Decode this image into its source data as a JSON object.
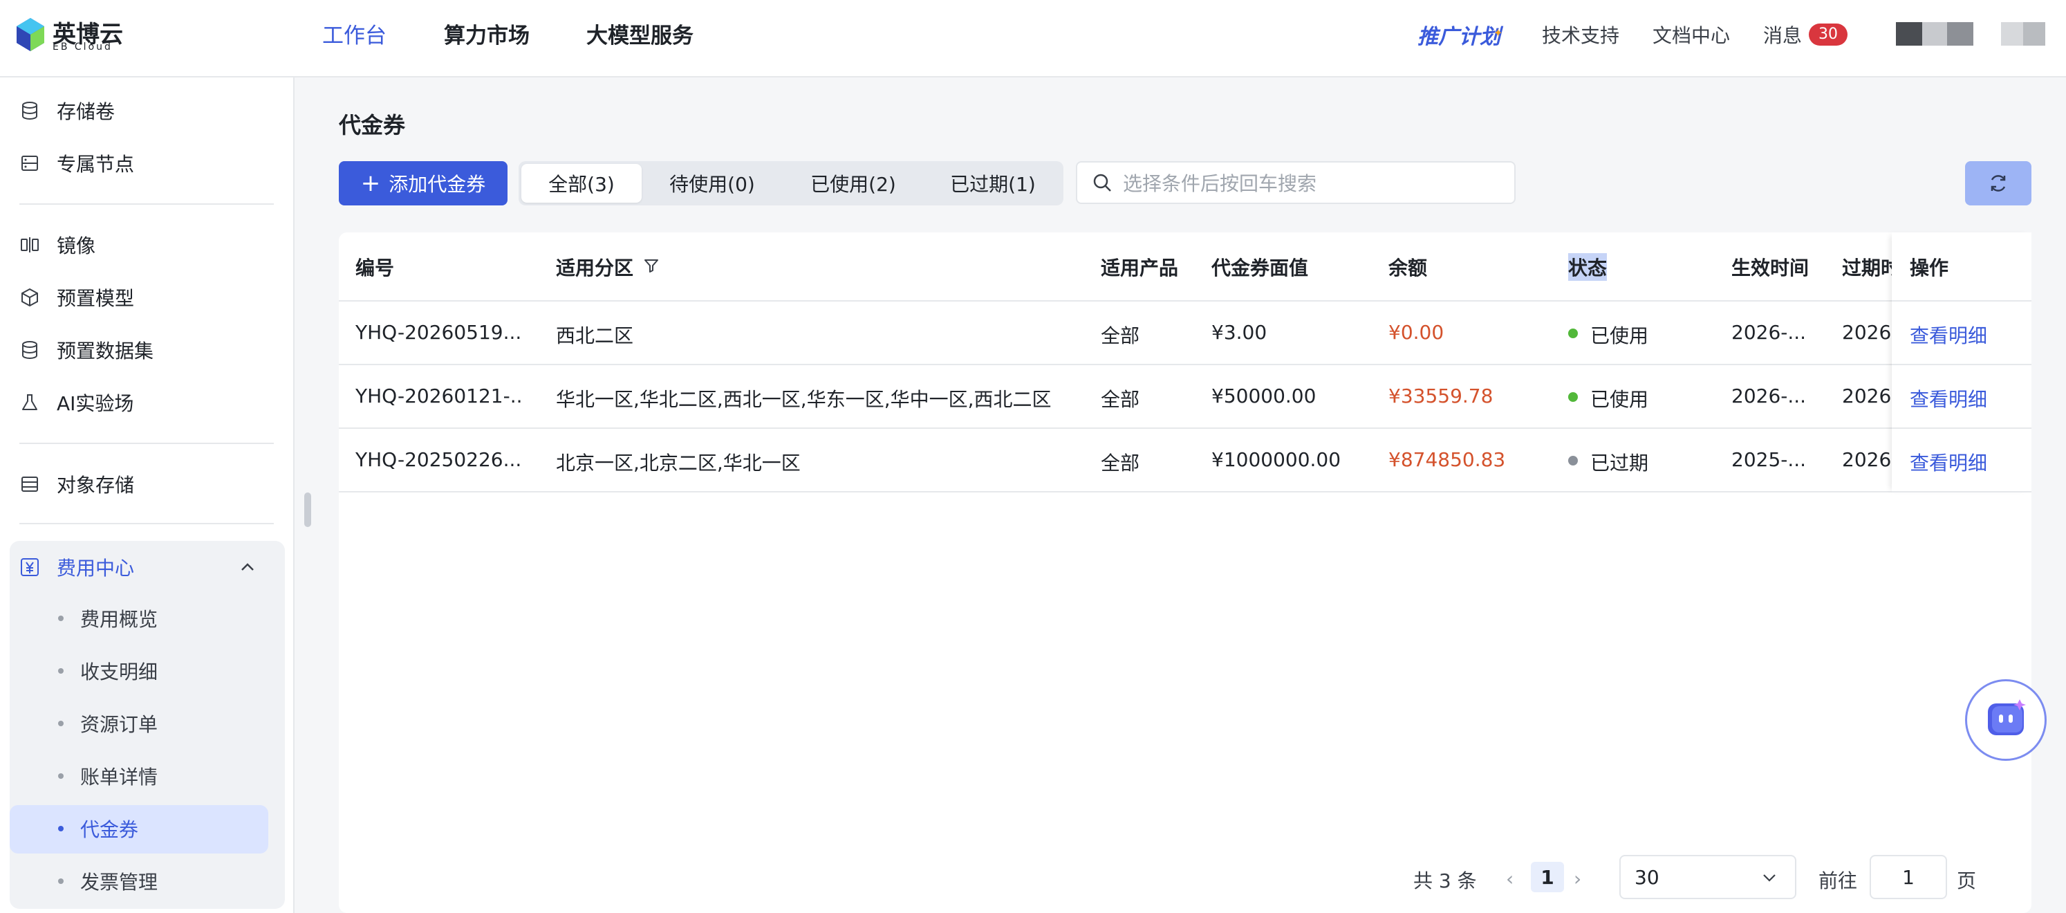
{
  "brand": {
    "name_cn": "英博云",
    "name_en": "EB Cloud"
  },
  "topnav": {
    "items": [
      {
        "label": "工作台",
        "active": true
      },
      {
        "label": "算力市场",
        "active": false
      },
      {
        "label": "大模型服务",
        "active": false
      }
    ],
    "promo": "推广计划",
    "links": [
      "技术支持",
      "文档中心",
      "消息"
    ],
    "message_count": "30"
  },
  "sidebar": {
    "items": [
      {
        "label": "存储卷",
        "icon": "database-icon"
      },
      {
        "label": "专属节点",
        "icon": "server-icon"
      },
      {
        "label": "镜像",
        "icon": "mirror-icon"
      },
      {
        "label": "预置模型",
        "icon": "cube-icon"
      },
      {
        "label": "预置数据集",
        "icon": "database-icon"
      },
      {
        "label": "AI实验场",
        "icon": "flask-icon"
      },
      {
        "label": "对象存储",
        "icon": "storage-icon"
      }
    ],
    "fee_center": {
      "label": "费用中心",
      "icon": "yen-icon",
      "expanded": true,
      "children": [
        "费用概览",
        "收支明细",
        "资源订单",
        "账单详情",
        "代金券",
        "发票管理"
      ],
      "active_child": "代金券"
    }
  },
  "main": {
    "title": "代金券",
    "add_button": "添加代金券",
    "tabs": [
      {
        "label": "全部(3)",
        "active": true
      },
      {
        "label": "待使用(0)",
        "active": false
      },
      {
        "label": "已使用(2)",
        "active": false
      },
      {
        "label": "已过期(1)",
        "active": false
      }
    ],
    "search": {
      "placeholder": "选择条件后按回车搜索",
      "value": ""
    }
  },
  "table": {
    "columns": [
      "编号",
      "适用分区",
      "适用产品",
      "代金券面值",
      "余额",
      "状态",
      "生效时间",
      "过期时",
      "操作"
    ],
    "rows": [
      {
        "id": "YHQ-20260519...",
        "regions": "西北二区",
        "product": "全部",
        "face_value": "¥3.00",
        "balance": "¥0.00",
        "status": "已使用",
        "status_color": "#52b83a",
        "start": "2026-...",
        "expire": "2026-",
        "action": "查看明细"
      },
      {
        "id": "YHQ-20260121-...",
        "regions": "华北一区,华北二区,西北一区,华东一区,华中一区,西北二区",
        "product": "全部",
        "face_value": "¥50000.00",
        "balance": "¥33559.78",
        "status": "已使用",
        "status_color": "#52b83a",
        "start": "2026-...",
        "expire": "2026-",
        "action": "查看明细"
      },
      {
        "id": "YHQ-20250226...",
        "regions": "北京一区,北京二区,华北一区",
        "product": "全部",
        "face_value": "¥1000000.00",
        "balance": "¥874850.83",
        "status": "已过期",
        "status_color": "#8a9099",
        "start": "2025-...",
        "expire": "2026-",
        "action": "查看明细"
      }
    ]
  },
  "pagination": {
    "total_text": "共 3 条",
    "current_page": "1",
    "page_size": "30",
    "goto_label": "前往",
    "goto_value": "1",
    "page_suffix": "页"
  },
  "colors": {
    "accent": "#3b5bdb",
    "amount": "#d4522c",
    "used": "#52b83a",
    "expired": "#8a9099",
    "badge": "#d9363e"
  }
}
